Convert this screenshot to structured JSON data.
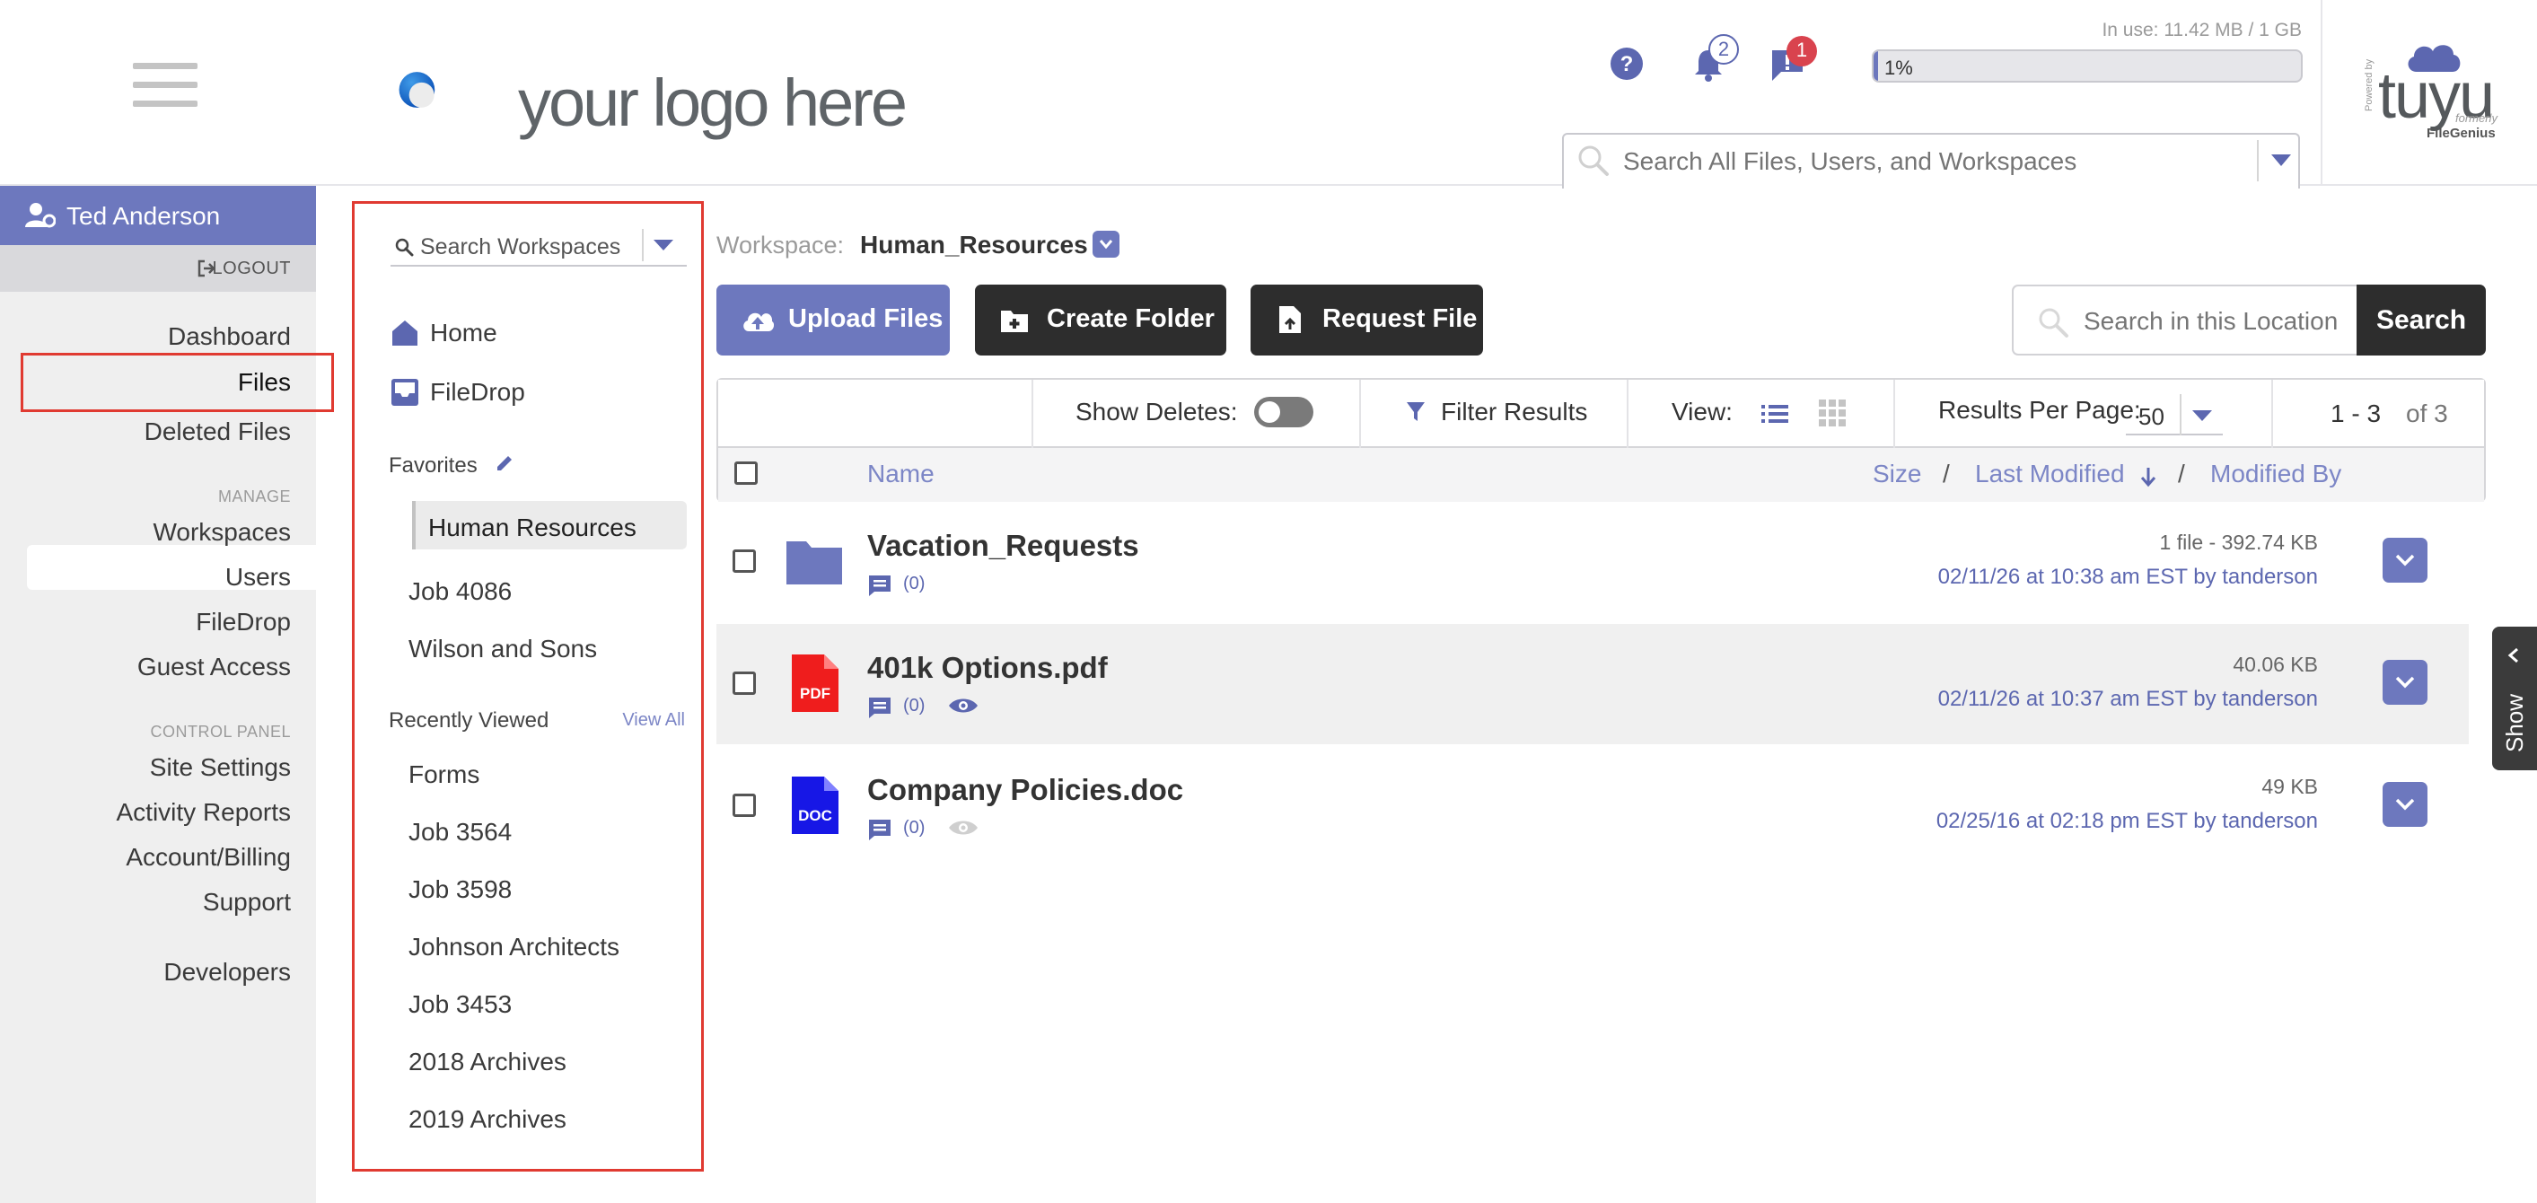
{
  "header": {
    "logo_text": "your logo here",
    "notifications_count": "2",
    "alerts_count": "1",
    "usage_label": "In use: 11.42 MB / 1 GB",
    "usage_percent_text": "1%",
    "usage_fraction": 0.01,
    "global_search_placeholder": "Search All Files, Users, and Workspaces",
    "brand": {
      "powered_by": "Powered by",
      "name": "tuyu",
      "formerly": "formerly",
      "former_name": "FileGenius"
    }
  },
  "leftnav": {
    "user_name": "Ted Anderson",
    "logout": "LOGOUT",
    "items": [
      "Dashboard",
      "Files",
      "Deleted Files"
    ],
    "manage_label": "MANAGE",
    "manage_items": [
      "Workspaces",
      "Users",
      "FileDrop",
      "Guest Access"
    ],
    "control_label": "CONTROL PANEL",
    "control_items": [
      "Site Settings",
      "Activity Reports",
      "Account/Billing",
      "Support"
    ],
    "developers": "Developers"
  },
  "workspaces": {
    "search_placeholder": "Search Workspaces",
    "home": "Home",
    "filedrop": "FileDrop",
    "favorites_label": "Favorites",
    "favorites": [
      "Human Resources",
      "Job 4086",
      "Wilson and Sons"
    ],
    "recent_label": "Recently Viewed",
    "view_all": "View All",
    "recent": [
      "Forms",
      "Job 3564",
      "Job 3598",
      "Johnson Architects",
      "Job 3453",
      "2018 Archives",
      "2019 Archives"
    ]
  },
  "main": {
    "workspace_label": "Workspace:",
    "workspace_name": "Human_Resources",
    "upload_label": "Upload Files",
    "create_folder_label": "Create Folder",
    "request_file_label": "Request File",
    "location_search_placeholder": "Search in this Location",
    "search_button": "Search",
    "show_deletes_label": "Show Deletes:",
    "filter_label": "Filter Results",
    "view_label": "View:",
    "results_per_page_label": "Results Per Page:",
    "results_per_page": "50",
    "page_range": "1 - 3",
    "page_total": "of 3",
    "columns": {
      "name": "Name",
      "size": "Size",
      "last_modified": "Last Modified",
      "modified_by": "Modified By"
    },
    "files": [
      {
        "name": "Vacation_Requests",
        "type": "folder",
        "size": "1 file - 392.74 KB",
        "modified": "02/11/26 at 10:38 am EST by tanderson",
        "comments": "(0)"
      },
      {
        "name": "401k Options.pdf",
        "type": "pdf",
        "icon_label": "PDF",
        "size": "40.06 KB",
        "modified": "02/11/26 at 10:37 am EST by tanderson",
        "comments": "(0)"
      },
      {
        "name": "Company Policies.doc",
        "type": "doc",
        "icon_label": "DOC",
        "size": "49 KB",
        "modified": "02/25/16 at 02:18 pm EST by tanderson",
        "comments": "(0)"
      }
    ],
    "show_tab": "Show"
  },
  "colors": {
    "accent": "#6d78be",
    "dark_button": "#2d2d2d",
    "pdf_red": "#ef1d1d",
    "doc_blue": "#1717e6",
    "highlight_red": "#e03a31"
  }
}
